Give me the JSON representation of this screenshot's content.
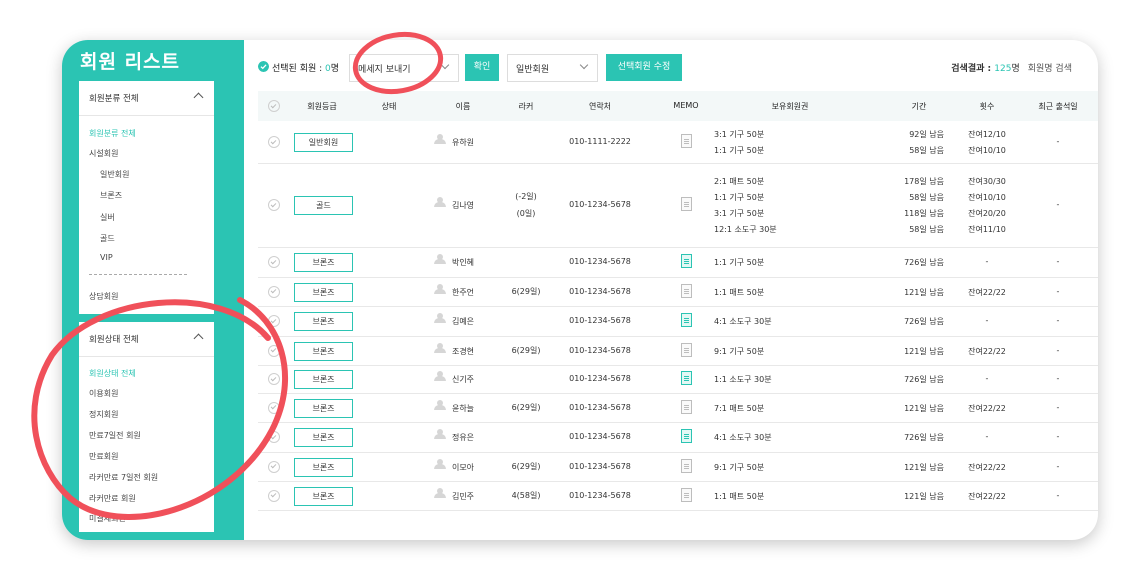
{
  "sidebar": {
    "title": "회원 리스트",
    "group1": {
      "header": "회원분류 전체",
      "items": [
        "회원분류 전체",
        "시설회원",
        "일반회원",
        "브론즈",
        "실버",
        "골드",
        "VIP"
      ],
      "extra": "상담회원"
    },
    "group2": {
      "header": "회원상태 전체",
      "items": [
        "회원상태 전체",
        "이용회원",
        "정지회원",
        "만료7일전 회원",
        "만료회원",
        "라커만료 7일전 회원",
        "라커만료 회원",
        "미결제회원"
      ]
    }
  },
  "toolbar": {
    "selected_label": "선택된 회원 : ",
    "selected_count": "0",
    "selected_suffix": "명",
    "message_select": "메세지 보내기",
    "confirm_button": "확인",
    "grade_select": "일반회원",
    "edit_button": "선택회원 수정",
    "result_label": "검색결과 : ",
    "result_count": "125",
    "result_suffix": "명",
    "search_label": "회원명 검색"
  },
  "table": {
    "headers": [
      "회원등급",
      "상태",
      "이름",
      "라커",
      "연락처",
      "MEMO",
      "보유회원권",
      "기간",
      "횟수",
      "최근 출석일"
    ],
    "rows": [
      {
        "grade": "일반회원",
        "name": "유하원",
        "locker": [],
        "phone": "010-1111-2222",
        "memo": "gray",
        "passes": [
          "3:1 기구 50분",
          "1:1 기구 50분"
        ],
        "periods": [
          "92일 남음",
          "58일 남음"
        ],
        "counts": [
          "잔여12/10",
          "잔여10/10"
        ],
        "last": "-"
      },
      {
        "grade": "골드",
        "name": "김나영",
        "locker": [
          "(-2일)",
          "(0일)"
        ],
        "phone": "010-1234-5678",
        "memo": "gray",
        "passes": [
          "2:1 매트 50분",
          "1:1 기구 50분",
          "3:1 기구 50분",
          "12:1 소도구 30분"
        ],
        "periods": [
          "178일 남음",
          "58일 남음",
          "118일 남음",
          "58일 남음"
        ],
        "counts": [
          "잔여30/30",
          "잔여10/10",
          "잔여20/20",
          "잔여11/10"
        ],
        "last": "-"
      },
      {
        "grade": "브론즈",
        "name": "박인혜",
        "locker": [],
        "phone": "010-1234-5678",
        "memo": "green",
        "passes": [
          "1:1 기구 50분"
        ],
        "periods": [
          "726일 남음"
        ],
        "counts": [
          "-"
        ],
        "last": "-"
      },
      {
        "grade": "브론즈",
        "name": "한주언",
        "locker": [
          "6(29일)"
        ],
        "phone": "010-1234-5678",
        "memo": "gray",
        "passes": [
          "1:1 매트 50분"
        ],
        "periods": [
          "121일 남음"
        ],
        "counts": [
          "잔여22/22"
        ],
        "last": "-"
      },
      {
        "grade": "브론즈",
        "name": "김예은",
        "locker": [],
        "phone": "010-1234-5678",
        "memo": "green",
        "passes": [
          "4:1 소도구 30분"
        ],
        "periods": [
          "726일 남음"
        ],
        "counts": [
          "-"
        ],
        "last": "-"
      },
      {
        "grade": "브론즈",
        "name": "조경현",
        "locker": [
          "6(29일)"
        ],
        "phone": "010-1234-5678",
        "memo": "gray",
        "passes": [
          "9:1 기구 50분"
        ],
        "periods": [
          "121일 남음"
        ],
        "counts": [
          "잔여22/22"
        ],
        "last": "-"
      },
      {
        "grade": "브론즈",
        "name": "신기주",
        "locker": [],
        "phone": "010-1234-5678",
        "memo": "green",
        "passes": [
          "1:1 소도구 30분"
        ],
        "periods": [
          "726일 남음"
        ],
        "counts": [
          "-"
        ],
        "last": "-"
      },
      {
        "grade": "브론즈",
        "name": "윤하늘",
        "locker": [
          "6(29일)"
        ],
        "phone": "010-1234-5678",
        "memo": "gray",
        "passes": [
          "7:1 매트 50분"
        ],
        "periods": [
          "121일 남음"
        ],
        "counts": [
          "잔여22/22"
        ],
        "last": "-"
      },
      {
        "grade": "브론즈",
        "name": "정유은",
        "locker": [],
        "phone": "010-1234-5678",
        "memo": "green",
        "passes": [
          "4:1 소도구 30분"
        ],
        "periods": [
          "726일 남음"
        ],
        "counts": [
          "-"
        ],
        "last": "-"
      },
      {
        "grade": "브론즈",
        "name": "이모아",
        "locker": [
          "6(29일)"
        ],
        "phone": "010-1234-5678",
        "memo": "gray",
        "passes": [
          "9:1 기구 50분"
        ],
        "periods": [
          "121일 남음"
        ],
        "counts": [
          "잔여22/22"
        ],
        "last": "-"
      },
      {
        "grade": "브론즈",
        "name": "김민주",
        "locker": [
          "4(58일)"
        ],
        "phone": "010-1234-5678",
        "memo": "gray",
        "passes": [
          "1:1 매트 50분"
        ],
        "periods": [
          "121일 남음"
        ],
        "counts": [
          "잔여22/22"
        ],
        "last": "-"
      }
    ]
  },
  "colors": {
    "accent": "#2bc4b3",
    "highlight_circle": "#f0505a"
  },
  "icons": [
    "check-circle-icon",
    "chevron-up-icon",
    "chevron-down-icon",
    "avatar-icon",
    "memo-icon"
  ]
}
